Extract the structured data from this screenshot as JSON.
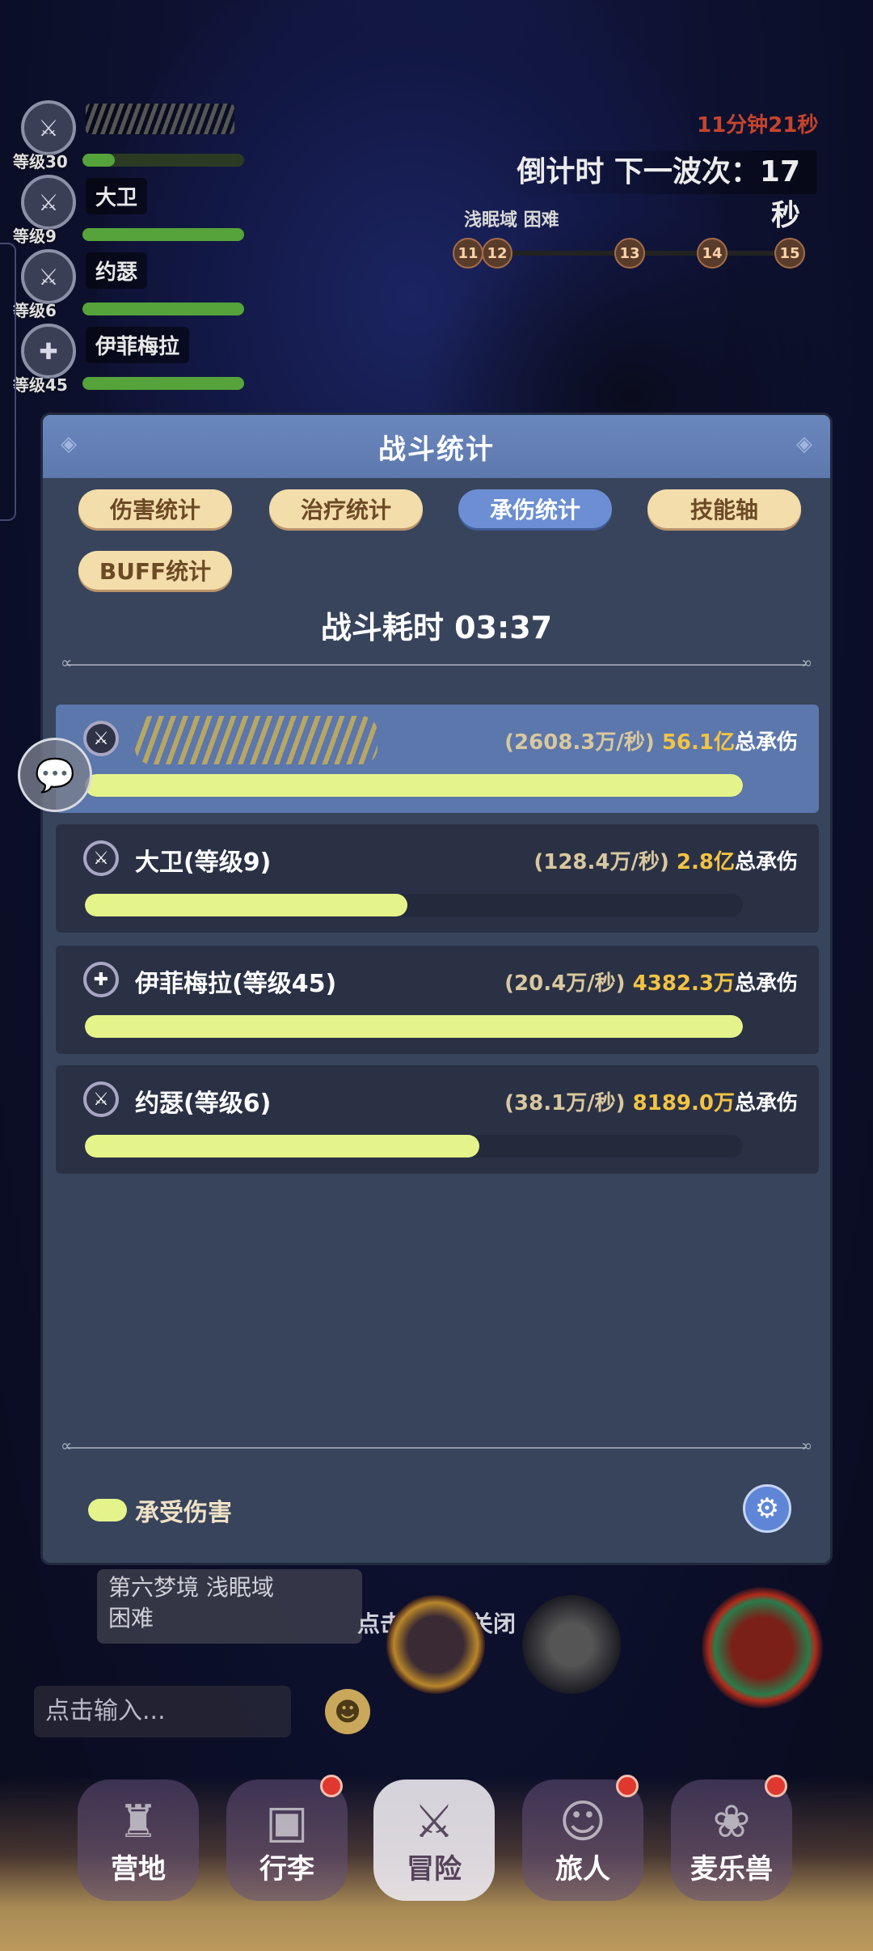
{
  "hud": {
    "party": [
      {
        "level": "等级30",
        "name": "",
        "hp": 0.2,
        "icon": "sword-icon"
      },
      {
        "level": "等级9",
        "name": "大卫",
        "hp": 1.0,
        "icon": "sword-icon"
      },
      {
        "level": "等级6",
        "name": "约瑟",
        "hp": 1.0,
        "icon": "sword-icon"
      },
      {
        "level": "等级45",
        "name": "伊菲梅拉",
        "hp": 1.0,
        "icon": "cross-icon"
      }
    ],
    "elapsed_red": "11分钟21秒",
    "countdown": "倒计时 下一波次：17秒",
    "zone": "浅眠域  困难",
    "waves": [
      "11",
      "12",
      "13",
      "14",
      "15"
    ]
  },
  "modal": {
    "title": "战斗统计",
    "tabs": [
      {
        "label": "伤害统计",
        "active": false
      },
      {
        "label": "治疗统计",
        "active": false
      },
      {
        "label": "承伤统计",
        "active": true
      },
      {
        "label": "技能轴",
        "active": false
      },
      {
        "label": "BUFF统计",
        "active": false
      }
    ],
    "duration": "战斗耗时  03:37",
    "rows": [
      {
        "name": "",
        "redacted": true,
        "rate": "(2608.3万/秒)",
        "total": "56.1亿",
        "suffix": "总承伤",
        "fill": 1.0
      },
      {
        "name": "大卫(等级9)",
        "redacted": false,
        "rate": "(128.4万/秒)",
        "total": "2.8亿",
        "suffix": "总承伤",
        "fill": 0.49
      },
      {
        "name": "伊菲梅拉(等级45)",
        "redacted": false,
        "rate": "(20.4万/秒)",
        "total": "4382.3万",
        "suffix": "总承伤",
        "fill": 1.0
      },
      {
        "name": "约瑟(等级6)",
        "redacted": false,
        "rate": "(38.1万/秒)",
        "total": "8189.0万",
        "suffix": "总承伤",
        "fill": 0.6
      }
    ],
    "legend": "承受伤害",
    "colors": {
      "bar": "#e5f48a",
      "total": "#f3c343",
      "header": "#6a87bd"
    }
  },
  "bottom": {
    "close_hint": "点击空白处关闭",
    "dream_text": "第六梦境  浅眠域\n困难",
    "chat_placeholder": "点击输入...",
    "nav": [
      {
        "label": "营地",
        "active": false,
        "badge": false,
        "icon": "castle-icon"
      },
      {
        "label": "行李",
        "active": false,
        "badge": true,
        "icon": "chest-icon"
      },
      {
        "label": "冒险",
        "active": true,
        "badge": false,
        "icon": "crossed-swords-icon"
      },
      {
        "label": "旅人",
        "active": false,
        "badge": true,
        "icon": "traveler-icon"
      },
      {
        "label": "麦乐兽",
        "active": false,
        "badge": true,
        "icon": "pet-icon"
      }
    ]
  }
}
